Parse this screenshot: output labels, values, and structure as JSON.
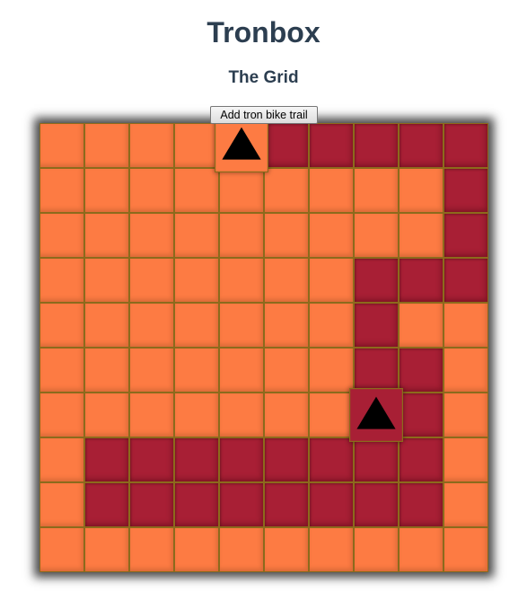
{
  "header": {
    "title": "Tronbox",
    "subtitle": "The Grid"
  },
  "controls": {
    "add_trail_label": "Add tron bike trail"
  },
  "colors": {
    "empty": "#fd7b43",
    "trail": "#a81f35",
    "bike": "#000000"
  },
  "grid": {
    "rows": [
      [
        "empty",
        "empty",
        "empty",
        "empty",
        "bike-empty",
        "trail",
        "trail",
        "trail",
        "trail",
        "trail"
      ],
      [
        "empty",
        "empty",
        "empty",
        "empty",
        "empty",
        "empty",
        "empty",
        "empty",
        "empty",
        "trail"
      ],
      [
        "empty",
        "empty",
        "empty",
        "empty",
        "empty",
        "empty",
        "empty",
        "empty",
        "empty",
        "trail"
      ],
      [
        "empty",
        "empty",
        "empty",
        "empty",
        "empty",
        "empty",
        "empty",
        "trail",
        "trail",
        "trail"
      ],
      [
        "empty",
        "empty",
        "empty",
        "empty",
        "empty",
        "empty",
        "empty",
        "trail",
        "empty",
        "empty"
      ],
      [
        "empty",
        "empty",
        "empty",
        "empty",
        "empty",
        "empty",
        "empty",
        "trail",
        "trail",
        "empty"
      ],
      [
        "empty",
        "empty",
        "empty",
        "empty",
        "empty",
        "empty",
        "empty",
        "bike-trail",
        "trail",
        "empty"
      ],
      [
        "empty",
        "trail",
        "trail",
        "trail",
        "trail",
        "trail",
        "trail",
        "trail",
        "trail",
        "empty"
      ],
      [
        "empty",
        "trail",
        "trail",
        "trail",
        "trail",
        "trail",
        "trail",
        "trail",
        "trail",
        "empty"
      ],
      [
        "empty",
        "empty",
        "empty",
        "empty",
        "empty",
        "empty",
        "empty",
        "empty",
        "empty",
        "empty"
      ]
    ],
    "bike_icon": "triangle-up-icon"
  }
}
